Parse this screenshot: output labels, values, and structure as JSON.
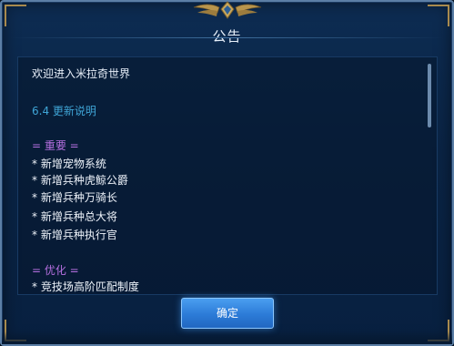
{
  "dialog": {
    "title": "公告",
    "welcome": "欢迎进入米拉奇世界",
    "version_heading": "6.4 更新说明",
    "sections": [
      {
        "heading": "= 重要 =",
        "items": [
          "* 新增宠物系统",
          "* 新增兵种虎鲸公爵",
          "* 新增兵种万骑长",
          "* 新增兵种总大将",
          "* 新增兵种执行官"
        ]
      },
      {
        "heading": "= 优化 =",
        "items": [
          "* 竞技场高阶匹配制度"
        ]
      }
    ],
    "confirm_label": "确定"
  },
  "colors": {
    "title_text": "#e9f1fb",
    "version_text": "#3fa5d6",
    "section_heading": "#b56fe0",
    "button": "#2c7bd7",
    "frame_gold": "#a88a4e"
  },
  "icons": {
    "crest": "winged-crest-emblem"
  }
}
